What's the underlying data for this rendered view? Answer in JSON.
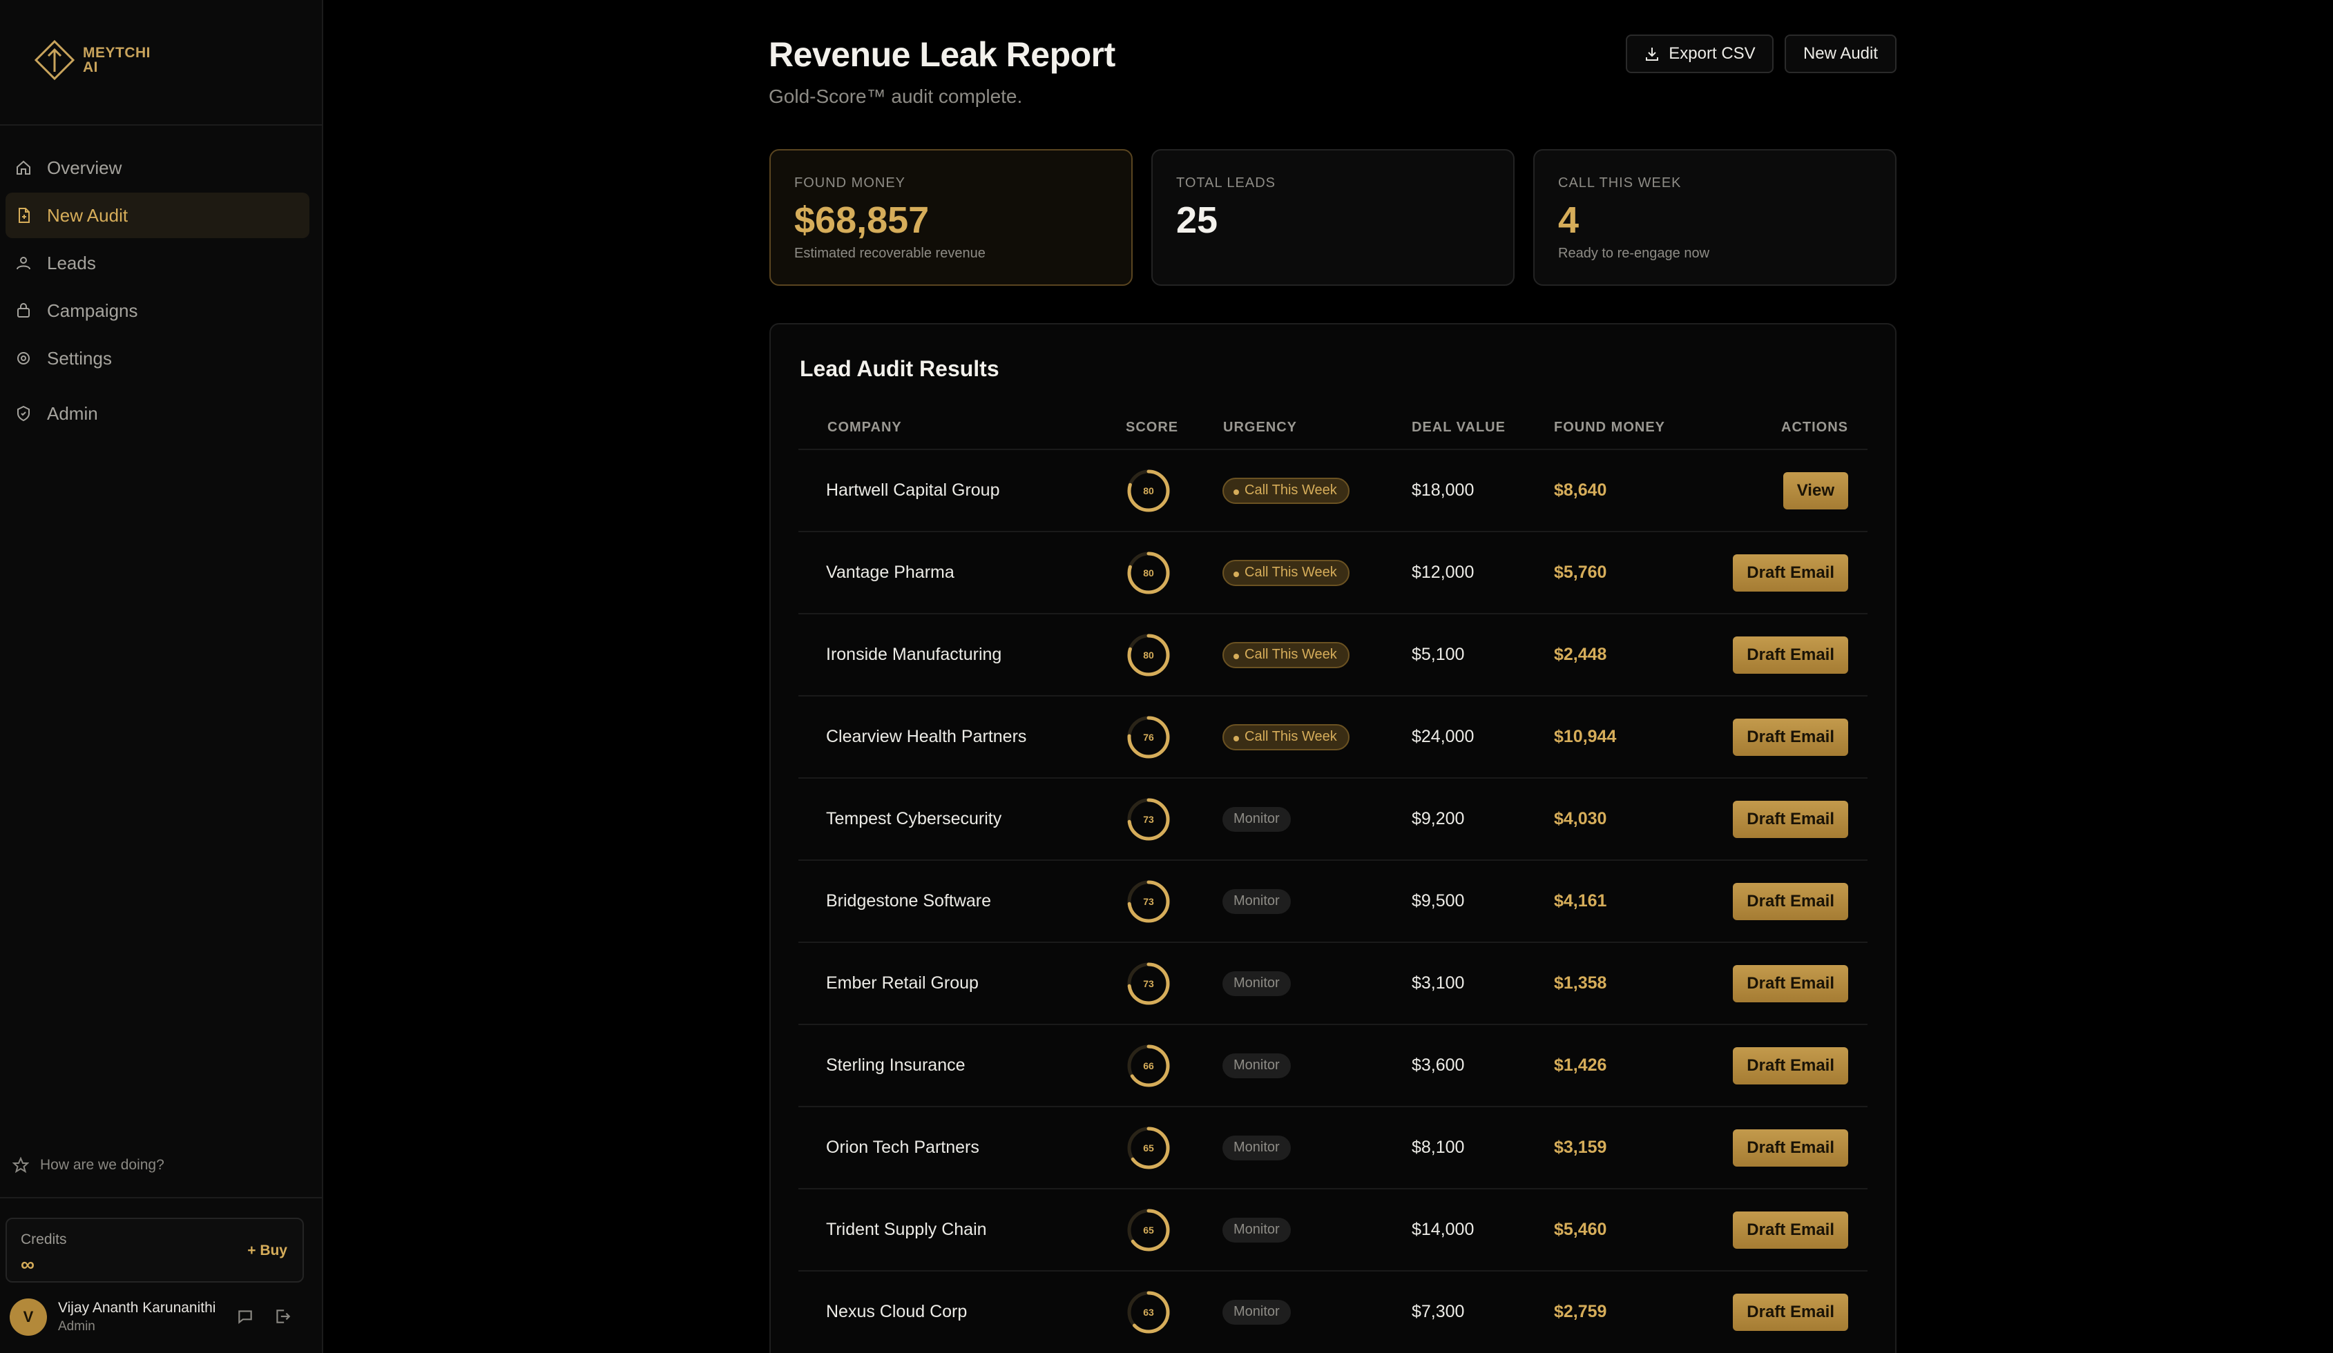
{
  "brand": {
    "line1": "MEYTCHI",
    "line2": "AI"
  },
  "sidebar": {
    "items": [
      {
        "label": "Overview",
        "icon": "home-icon"
      },
      {
        "label": "New Audit",
        "icon": "document-icon",
        "active": true
      },
      {
        "label": "Leads",
        "icon": "users-icon"
      },
      {
        "label": "Campaigns",
        "icon": "bag-icon"
      },
      {
        "label": "Settings",
        "icon": "gear-icon"
      },
      {
        "label": "Admin",
        "icon": "shield-icon"
      }
    ],
    "feedback": "How are we doing?",
    "credits_label": "Credits",
    "credits_value": "∞",
    "buy_label": "+ Buy",
    "user_initial": "V",
    "user_name": "Vijay Ananth Karunanithi",
    "user_role": "Admin"
  },
  "header": {
    "title": "Revenue Leak Report",
    "subtitle": "Gold-Score™ audit complete.",
    "export_label": "Export CSV",
    "new_audit_label": "New Audit"
  },
  "stats": [
    {
      "label": "FOUND MONEY",
      "value": "$68,857",
      "sub": "Estimated recoverable revenue"
    },
    {
      "label": "TOTAL LEADS",
      "value": "25",
      "sub": ""
    },
    {
      "label": "CALL THIS WEEK",
      "value": "4",
      "sub": "Ready to re-engage now"
    }
  ],
  "table": {
    "title": "Lead Audit Results",
    "columns": [
      "COMPANY",
      "SCORE",
      "URGENCY",
      "DEAL VALUE",
      "FOUND MONEY",
      "ACTIONS"
    ],
    "rows": [
      {
        "company": "Hartwell Capital Group",
        "score": 80,
        "urgency": "Call This Week",
        "deal": "$18,000",
        "found": "$8,640",
        "action": "View"
      },
      {
        "company": "Vantage Pharma",
        "score": 80,
        "urgency": "Call This Week",
        "deal": "$12,000",
        "found": "$5,760",
        "action": "Draft Email"
      },
      {
        "company": "Ironside Manufacturing",
        "score": 80,
        "urgency": "Call This Week",
        "deal": "$5,100",
        "found": "$2,448",
        "action": "Draft Email"
      },
      {
        "company": "Clearview Health Partners",
        "score": 76,
        "urgency": "Call This Week",
        "deal": "$24,000",
        "found": "$10,944",
        "action": "Draft Email"
      },
      {
        "company": "Tempest Cybersecurity",
        "score": 73,
        "urgency": "Monitor",
        "deal": "$9,200",
        "found": "$4,030",
        "action": "Draft Email"
      },
      {
        "company": "Bridgestone Software",
        "score": 73,
        "urgency": "Monitor",
        "deal": "$9,500",
        "found": "$4,161",
        "action": "Draft Email"
      },
      {
        "company": "Ember Retail Group",
        "score": 73,
        "urgency": "Monitor",
        "deal": "$3,100",
        "found": "$1,358",
        "action": "Draft Email"
      },
      {
        "company": "Sterling Insurance",
        "score": 66,
        "urgency": "Monitor",
        "deal": "$3,600",
        "found": "$1,426",
        "action": "Draft Email"
      },
      {
        "company": "Orion Tech Partners",
        "score": 65,
        "urgency": "Monitor",
        "deal": "$8,100",
        "found": "$3,159",
        "action": "Draft Email"
      },
      {
        "company": "Trident Supply Chain",
        "score": 65,
        "urgency": "Monitor",
        "deal": "$14,000",
        "found": "$5,460",
        "action": "Draft Email"
      },
      {
        "company": "Nexus Cloud Corp",
        "score": 63,
        "urgency": "Monitor",
        "deal": "$7,300",
        "found": "$2,759",
        "action": "Draft Email"
      }
    ]
  },
  "colors": {
    "gold": "#d6ad5a",
    "background": "#000000",
    "panel": "#0b0b0b"
  }
}
